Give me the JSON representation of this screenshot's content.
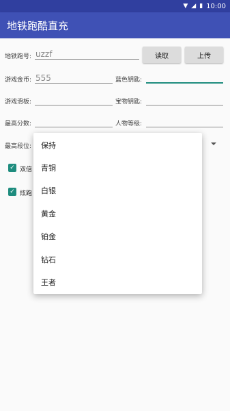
{
  "status_bar": {
    "time": "10:00",
    "icons": [
      "wifi-icon",
      "signal-icon",
      "battery-icon"
    ]
  },
  "app_bar": {
    "title": "地铁跑酷直充"
  },
  "form": {
    "subway_id": {
      "label": "地铁跑号:",
      "value": "uzzf"
    },
    "read_button": "读取",
    "upload_button": "上传",
    "coins": {
      "label": "游戏金币:",
      "value": "555"
    },
    "blue_keys": {
      "label": "蓝色钥匙:",
      "value": ""
    },
    "skateboard": {
      "label": "游戏滑板:",
      "value": ""
    },
    "treasure_keys": {
      "label": "宝物钥匙:",
      "value": ""
    },
    "high_score": {
      "label": "最高分数:",
      "value": ""
    },
    "char_level": {
      "label": "人物等级:",
      "value": ""
    },
    "max_rank": {
      "label": "最高段位:"
    },
    "checkbox_1": {
      "label": "双倍",
      "checked": true
    },
    "checkbox_2": {
      "label": "炫跑",
      "checked": true
    }
  },
  "dropdown_options": [
    "保持",
    "青铜",
    "白银",
    "黄金",
    "铂金",
    "钻石",
    "王者"
  ],
  "colors": {
    "primary": "#3F51B5",
    "primary_dark": "#303F9F",
    "accent": "#1E8C7E"
  }
}
